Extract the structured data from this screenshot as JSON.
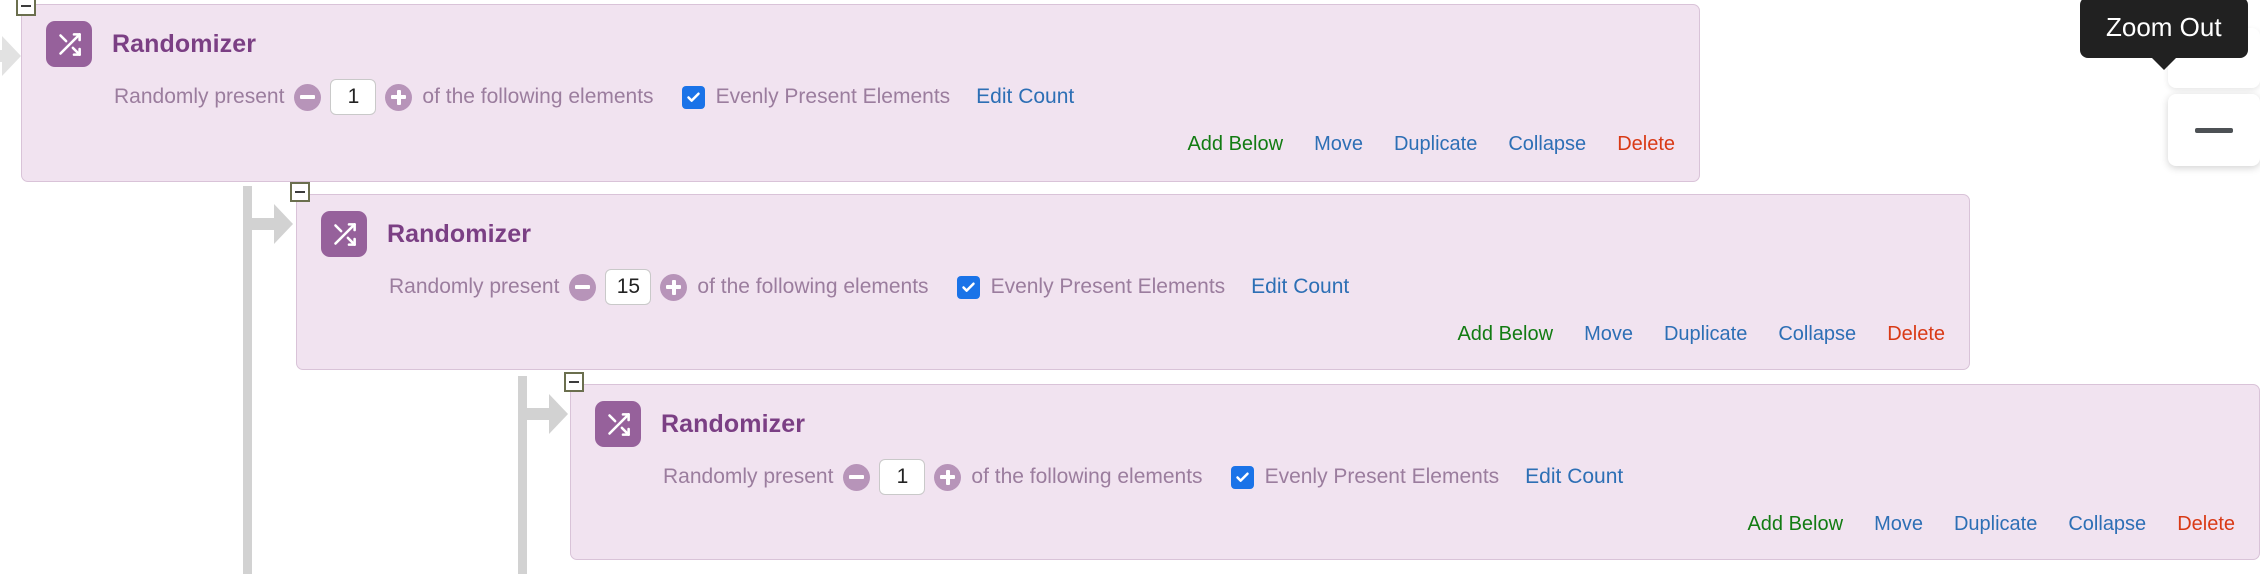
{
  "app": {
    "background": "#ffffff",
    "block_bg": "#f1e3f0",
    "block_border": "#d9c3d8",
    "icon_bg": "#96619b",
    "title_color": "#7b3f84",
    "label_color": "#9b7d9e",
    "link_color": "#2d6fb5",
    "add_color": "#127b12",
    "delete_color": "#d93a16",
    "checkbox_color": "#1a73e8",
    "guide_color": "#d2d2d2",
    "toggle_border": "#6b6f4e",
    "tooltip_bg": "#212121"
  },
  "tooltip": {
    "label": "Zoom Out"
  },
  "zoom_controls": {
    "zoom_out_icon": "minus-icon"
  },
  "blocks": [
    {
      "icon": "shuffle-icon",
      "title": "Randomizer",
      "prefix_label": "Randomly present",
      "decrement_icon": "minus-circle-icon",
      "count": "1",
      "increment_icon": "plus-circle-icon",
      "suffix_label": "of the following elements",
      "checkbox_checked": true,
      "checkbox_label": "Evenly Present Elements",
      "edit_count_label": "Edit Count",
      "collapse_toggle_icon": "minus-box-icon",
      "actions": [
        {
          "label": "Add Below",
          "kind": "green"
        },
        {
          "label": "Move",
          "kind": "blue"
        },
        {
          "label": "Duplicate",
          "kind": "blue"
        },
        {
          "label": "Collapse",
          "kind": "blue"
        },
        {
          "label": "Delete",
          "kind": "red"
        }
      ]
    },
    {
      "icon": "shuffle-icon",
      "title": "Randomizer",
      "prefix_label": "Randomly present",
      "decrement_icon": "minus-circle-icon",
      "count": "15",
      "increment_icon": "plus-circle-icon",
      "suffix_label": "of the following elements",
      "checkbox_checked": true,
      "checkbox_label": "Evenly Present Elements",
      "edit_count_label": "Edit Count",
      "collapse_toggle_icon": "minus-box-icon",
      "actions": [
        {
          "label": "Add Below",
          "kind": "green"
        },
        {
          "label": "Move",
          "kind": "blue"
        },
        {
          "label": "Duplicate",
          "kind": "blue"
        },
        {
          "label": "Collapse",
          "kind": "blue"
        },
        {
          "label": "Delete",
          "kind": "red"
        }
      ]
    },
    {
      "icon": "shuffle-icon",
      "title": "Randomizer",
      "prefix_label": "Randomly present",
      "decrement_icon": "minus-circle-icon",
      "count": "1",
      "increment_icon": "plus-circle-icon",
      "suffix_label": "of the following elements",
      "checkbox_checked": true,
      "checkbox_label": "Evenly Present Elements",
      "edit_count_label": "Edit Count",
      "collapse_toggle_icon": "minus-box-icon",
      "actions": [
        {
          "label": "Add Below",
          "kind": "green"
        },
        {
          "label": "Move",
          "kind": "blue"
        },
        {
          "label": "Duplicate",
          "kind": "blue"
        },
        {
          "label": "Collapse",
          "kind": "blue"
        },
        {
          "label": "Delete",
          "kind": "red"
        }
      ]
    }
  ]
}
